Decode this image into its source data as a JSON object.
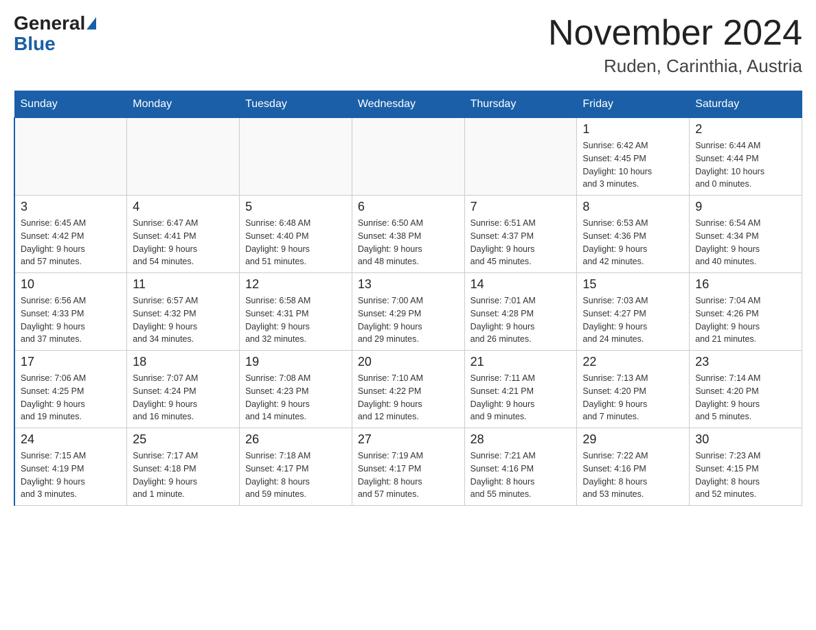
{
  "header": {
    "logo_general": "General",
    "logo_blue": "Blue",
    "title": "November 2024",
    "subtitle": "Ruden, Carinthia, Austria"
  },
  "days_of_week": [
    "Sunday",
    "Monday",
    "Tuesday",
    "Wednesday",
    "Thursday",
    "Friday",
    "Saturday"
  ],
  "weeks": [
    [
      {
        "day": "",
        "info": ""
      },
      {
        "day": "",
        "info": ""
      },
      {
        "day": "",
        "info": ""
      },
      {
        "day": "",
        "info": ""
      },
      {
        "day": "",
        "info": ""
      },
      {
        "day": "1",
        "info": "Sunrise: 6:42 AM\nSunset: 4:45 PM\nDaylight: 10 hours\nand 3 minutes."
      },
      {
        "day": "2",
        "info": "Sunrise: 6:44 AM\nSunset: 4:44 PM\nDaylight: 10 hours\nand 0 minutes."
      }
    ],
    [
      {
        "day": "3",
        "info": "Sunrise: 6:45 AM\nSunset: 4:42 PM\nDaylight: 9 hours\nand 57 minutes."
      },
      {
        "day": "4",
        "info": "Sunrise: 6:47 AM\nSunset: 4:41 PM\nDaylight: 9 hours\nand 54 minutes."
      },
      {
        "day": "5",
        "info": "Sunrise: 6:48 AM\nSunset: 4:40 PM\nDaylight: 9 hours\nand 51 minutes."
      },
      {
        "day": "6",
        "info": "Sunrise: 6:50 AM\nSunset: 4:38 PM\nDaylight: 9 hours\nand 48 minutes."
      },
      {
        "day": "7",
        "info": "Sunrise: 6:51 AM\nSunset: 4:37 PM\nDaylight: 9 hours\nand 45 minutes."
      },
      {
        "day": "8",
        "info": "Sunrise: 6:53 AM\nSunset: 4:36 PM\nDaylight: 9 hours\nand 42 minutes."
      },
      {
        "day": "9",
        "info": "Sunrise: 6:54 AM\nSunset: 4:34 PM\nDaylight: 9 hours\nand 40 minutes."
      }
    ],
    [
      {
        "day": "10",
        "info": "Sunrise: 6:56 AM\nSunset: 4:33 PM\nDaylight: 9 hours\nand 37 minutes."
      },
      {
        "day": "11",
        "info": "Sunrise: 6:57 AM\nSunset: 4:32 PM\nDaylight: 9 hours\nand 34 minutes."
      },
      {
        "day": "12",
        "info": "Sunrise: 6:58 AM\nSunset: 4:31 PM\nDaylight: 9 hours\nand 32 minutes."
      },
      {
        "day": "13",
        "info": "Sunrise: 7:00 AM\nSunset: 4:29 PM\nDaylight: 9 hours\nand 29 minutes."
      },
      {
        "day": "14",
        "info": "Sunrise: 7:01 AM\nSunset: 4:28 PM\nDaylight: 9 hours\nand 26 minutes."
      },
      {
        "day": "15",
        "info": "Sunrise: 7:03 AM\nSunset: 4:27 PM\nDaylight: 9 hours\nand 24 minutes."
      },
      {
        "day": "16",
        "info": "Sunrise: 7:04 AM\nSunset: 4:26 PM\nDaylight: 9 hours\nand 21 minutes."
      }
    ],
    [
      {
        "day": "17",
        "info": "Sunrise: 7:06 AM\nSunset: 4:25 PM\nDaylight: 9 hours\nand 19 minutes."
      },
      {
        "day": "18",
        "info": "Sunrise: 7:07 AM\nSunset: 4:24 PM\nDaylight: 9 hours\nand 16 minutes."
      },
      {
        "day": "19",
        "info": "Sunrise: 7:08 AM\nSunset: 4:23 PM\nDaylight: 9 hours\nand 14 minutes."
      },
      {
        "day": "20",
        "info": "Sunrise: 7:10 AM\nSunset: 4:22 PM\nDaylight: 9 hours\nand 12 minutes."
      },
      {
        "day": "21",
        "info": "Sunrise: 7:11 AM\nSunset: 4:21 PM\nDaylight: 9 hours\nand 9 minutes."
      },
      {
        "day": "22",
        "info": "Sunrise: 7:13 AM\nSunset: 4:20 PM\nDaylight: 9 hours\nand 7 minutes."
      },
      {
        "day": "23",
        "info": "Sunrise: 7:14 AM\nSunset: 4:20 PM\nDaylight: 9 hours\nand 5 minutes."
      }
    ],
    [
      {
        "day": "24",
        "info": "Sunrise: 7:15 AM\nSunset: 4:19 PM\nDaylight: 9 hours\nand 3 minutes."
      },
      {
        "day": "25",
        "info": "Sunrise: 7:17 AM\nSunset: 4:18 PM\nDaylight: 9 hours\nand 1 minute."
      },
      {
        "day": "26",
        "info": "Sunrise: 7:18 AM\nSunset: 4:17 PM\nDaylight: 8 hours\nand 59 minutes."
      },
      {
        "day": "27",
        "info": "Sunrise: 7:19 AM\nSunset: 4:17 PM\nDaylight: 8 hours\nand 57 minutes."
      },
      {
        "day": "28",
        "info": "Sunrise: 7:21 AM\nSunset: 4:16 PM\nDaylight: 8 hours\nand 55 minutes."
      },
      {
        "day": "29",
        "info": "Sunrise: 7:22 AM\nSunset: 4:16 PM\nDaylight: 8 hours\nand 53 minutes."
      },
      {
        "day": "30",
        "info": "Sunrise: 7:23 AM\nSunset: 4:15 PM\nDaylight: 8 hours\nand 52 minutes."
      }
    ]
  ]
}
